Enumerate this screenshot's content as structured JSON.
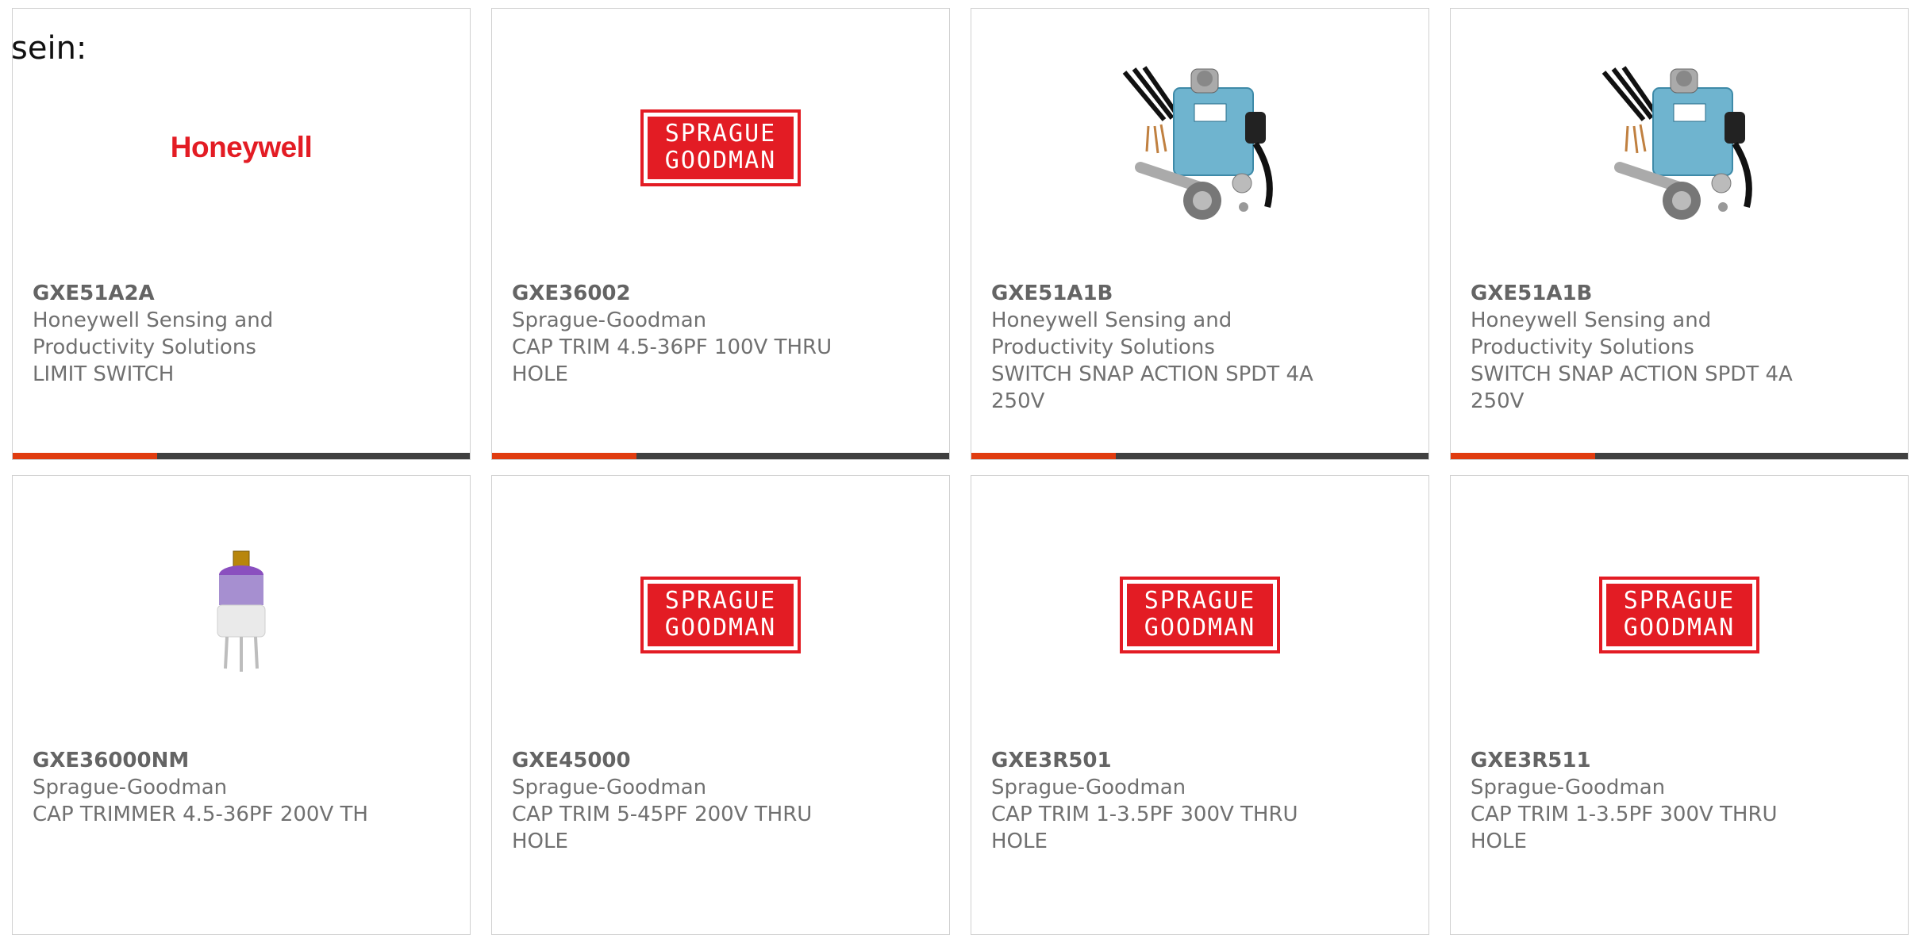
{
  "intro_text": "sein:",
  "colors": {
    "accent": "#e03c10",
    "bar": "#404040",
    "brand_red": "#e31c24"
  },
  "products": [
    {
      "part": "GXE51A2A",
      "manufacturer": "Honeywell Sensing and Productivity Solutions",
      "description": "LIMIT SWITCH",
      "image": "honeywell-logo",
      "logo_text": "Honeywell"
    },
    {
      "part": "GXE36002",
      "manufacturer": "Sprague-Goodman",
      "description": "CAP TRIM 4.5-36PF 100V THRU HOLE",
      "image": "sprague-goodman-logo",
      "logo_line1": "SPRAGUE",
      "logo_line2": "GOODMAN"
    },
    {
      "part": "GXE51A1B",
      "manufacturer": "Honeywell Sensing and Productivity Solutions",
      "description": "SWITCH SNAP ACTION SPDT 4A 250V",
      "image": "limit-switch-photo"
    },
    {
      "part": "GXE51A1B",
      "manufacturer": "Honeywell Sensing and Productivity Solutions",
      "description": "SWITCH SNAP ACTION SPDT 4A 250V",
      "image": "limit-switch-photo"
    },
    {
      "part": "GXE36000NM",
      "manufacturer": "Sprague-Goodman",
      "description": "CAP TRIMMER 4.5-36PF 200V TH",
      "image": "trimmer-capacitor-photo"
    },
    {
      "part": "GXE45000",
      "manufacturer": "Sprague-Goodman",
      "description": "CAP TRIM 5-45PF 200V THRU HOLE",
      "image": "sprague-goodman-logo",
      "logo_line1": "SPRAGUE",
      "logo_line2": "GOODMAN"
    },
    {
      "part": "GXE3R501",
      "manufacturer": "Sprague-Goodman",
      "description": "CAP TRIM 1-3.5PF 300V THRU HOLE",
      "image": "sprague-goodman-logo",
      "logo_line1": "SPRAGUE",
      "logo_line2": "GOODMAN"
    },
    {
      "part": "GXE3R511",
      "manufacturer": "Sprague-Goodman",
      "description": "CAP TRIM 1-3.5PF 300V THRU HOLE",
      "image": "sprague-goodman-logo",
      "logo_line1": "SPRAGUE",
      "logo_line2": "GOODMAN"
    }
  ]
}
